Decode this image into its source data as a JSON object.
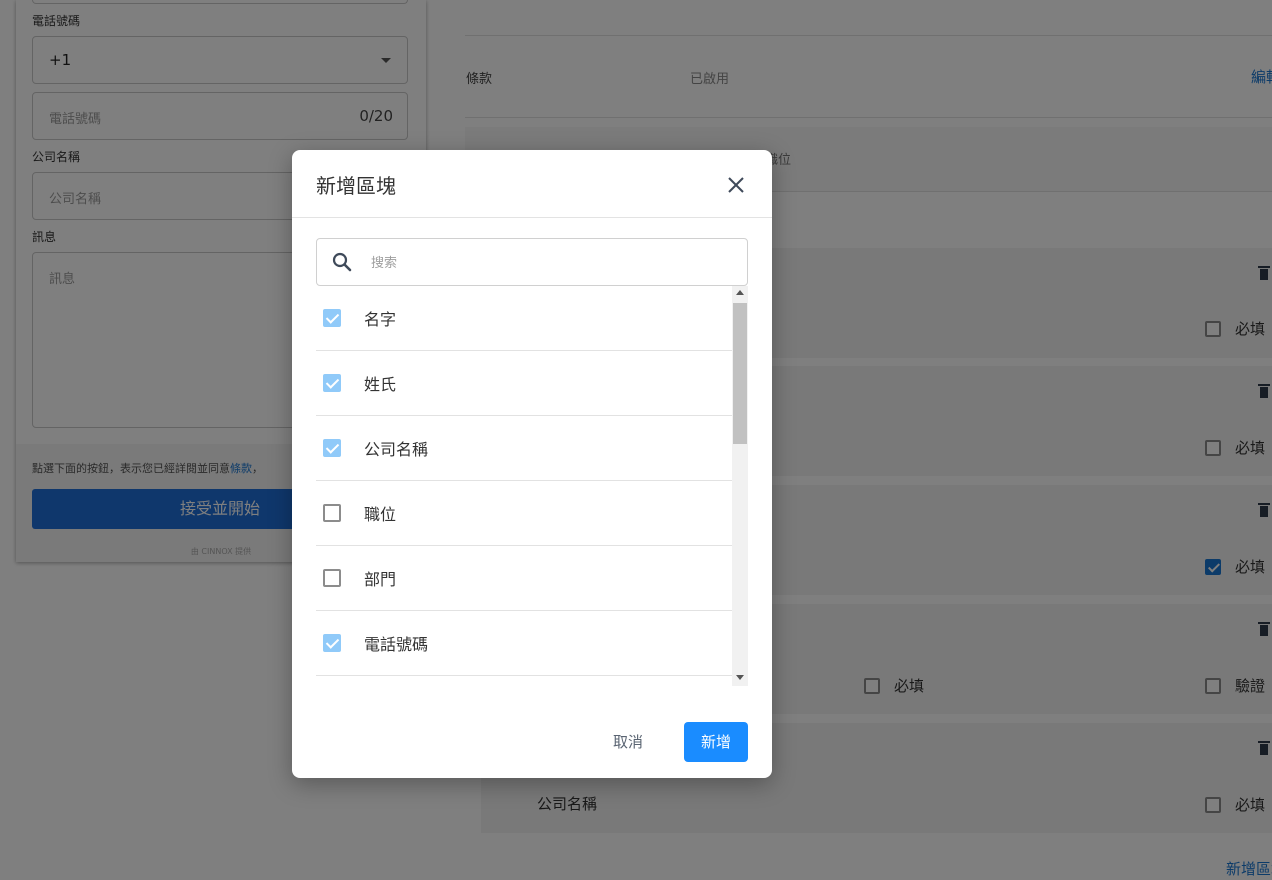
{
  "preview": {
    "phone_label": "電話號碼",
    "country_code": "+1",
    "phone_placeholder": "電話號碼",
    "phone_counter": "0/20",
    "company_label": "公司名稱",
    "company_placeholder": "公司名稱",
    "message_label": "訊息",
    "message_placeholder": "訊息",
    "terms_text": "點選下面的按鈕，表示您已經詳閱並同意",
    "terms_link": "條款",
    "terms_suffix": "，",
    "accept_button": "接受並開始",
    "powered_by": "由 CINNOX 提供"
  },
  "settings": {
    "terms_label": "條款",
    "terms_status": "已啟用",
    "edit_link": "編輯",
    "position_fragment": "職位",
    "blocks": [
      {
        "required_label": "必填",
        "required_checked": false
      },
      {
        "required_label": "必填",
        "required_checked": false
      },
      {
        "required_label": "必填",
        "required_checked": true
      },
      {
        "required_label": "必填",
        "required_checked": false,
        "verify_label": "驗證",
        "verify_checked": false
      },
      {
        "field_name": "公司名稱",
        "required_label": "必填",
        "required_checked": false
      }
    ],
    "add_block_link": "新增區塊"
  },
  "modal": {
    "title": "新增區塊",
    "search_placeholder": "搜索",
    "items": [
      {
        "label": "名字",
        "checked": true
      },
      {
        "label": "姓氏",
        "checked": true
      },
      {
        "label": "公司名稱",
        "checked": true
      },
      {
        "label": "職位",
        "checked": false
      },
      {
        "label": "部門",
        "checked": false
      },
      {
        "label": "電話號碼",
        "checked": true
      }
    ],
    "cancel_label": "取消",
    "add_label": "新增"
  },
  "colors": {
    "primary": "#1a8cff",
    "accept_button": "#1e6fd9",
    "checkbox_checked_disabled": "#90caf9",
    "overlay": "rgba(0,0,0,0.5)"
  }
}
